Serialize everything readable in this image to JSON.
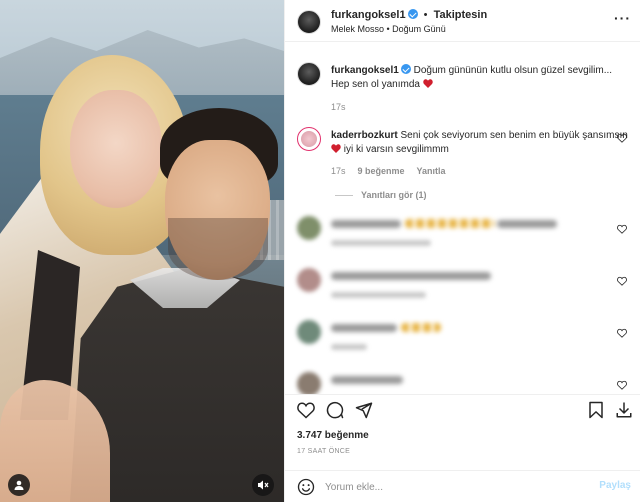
{
  "header": {
    "username": "furkangoksel1",
    "separator": "•",
    "follow_status": "Takiptesin",
    "subtitle": "Melek Mosso • Doğum Günü"
  },
  "caption": {
    "username": "furkangoksel1",
    "text": "Doğum gününün kutlu olsun güzel sevgilim... Hep sen ol yanımda",
    "time": "17s"
  },
  "comment": {
    "username": "kaderrbozkurt",
    "text_before_heart": "Seni çok seviyorum sen benim en büyük şansımsın",
    "text_after_heart": "iyi ki varsın sevgilimmm",
    "time": "17s",
    "likes": "9 beğenme",
    "reply": "Yanıtla",
    "view_replies": "Yanıtları gör (1)"
  },
  "post": {
    "likes": "3.747 beğenme",
    "time": "17 SAAT ÖNCE"
  },
  "add_comment": {
    "placeholder": "Yorum ekle...",
    "post_label": "Paylaş"
  },
  "colors": {
    "accent": "#3897f0",
    "heart": "#ed4956",
    "story_ring": "#e1306c"
  },
  "icons": [
    "more-icon",
    "heart-icon",
    "comment-icon",
    "share-icon",
    "bookmark-icon",
    "download-icon",
    "emoji-icon",
    "tag-user-icon",
    "mute-icon",
    "verified-icon"
  ]
}
